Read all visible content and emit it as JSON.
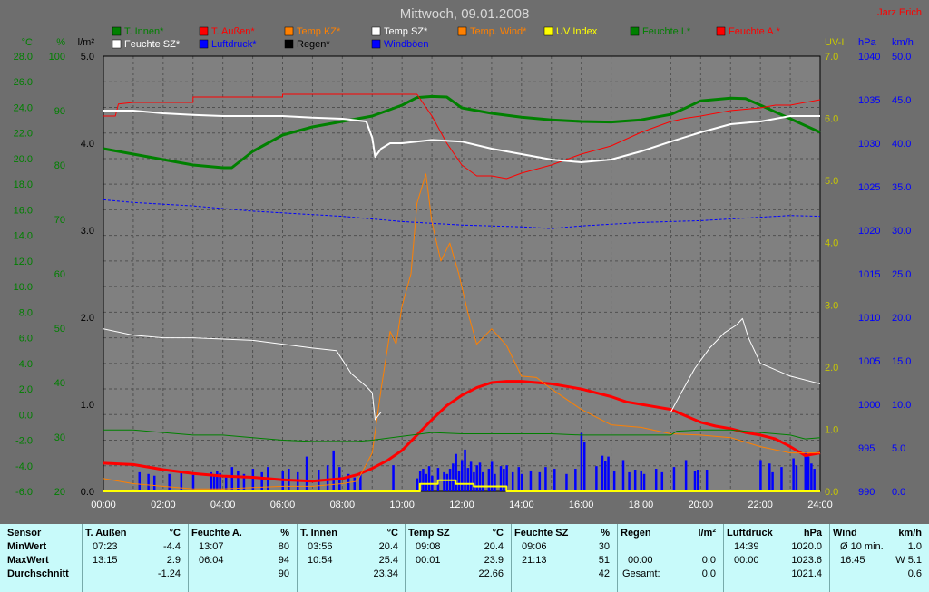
{
  "chart_data": {
    "type": "line",
    "title": "Mittwoch, 09.01.2008",
    "author": "Jarz Erich",
    "x_ticks": [
      "00:00",
      "02:00",
      "04:00",
      "06:00",
      "08:00",
      "10:00",
      "12:00",
      "14:00",
      "16:00",
      "18:00",
      "20:00",
      "22:00",
      "24:00"
    ],
    "xlim": [
      0,
      24
    ],
    "axes_left": [
      {
        "unit": "°C",
        "color": "#008000",
        "ticks": [
          "-6.0",
          "-4.0",
          "-2.0",
          "0.0",
          "2.0",
          "4.0",
          "6.0",
          "8.0",
          "10.0",
          "12.0",
          "14.0",
          "16.0",
          "18.0",
          "20.0",
          "22.0",
          "24.0",
          "26.0",
          "28.0"
        ],
        "ylim": [
          -6,
          28
        ]
      },
      {
        "unit": "%",
        "color": "#008000",
        "ticks": [
          "20",
          "30",
          "40",
          "50",
          "60",
          "70",
          "80",
          "90",
          "100"
        ],
        "ylim": [
          20,
          100
        ]
      },
      {
        "unit": "l/m²",
        "color": "#000000",
        "ticks": [
          "0.0",
          "1.0",
          "2.0",
          "3.0",
          "4.0",
          "5.0"
        ],
        "ylim": [
          0,
          5
        ]
      }
    ],
    "axes_right": [
      {
        "unit": "UV-I",
        "color": "#c8c800",
        "ticks": [
          "0.0",
          "1.0",
          "2.0",
          "3.0",
          "4.0",
          "5.0",
          "6.0",
          "7.0"
        ],
        "ylim": [
          0,
          7
        ]
      },
      {
        "unit": "hPa",
        "color": "#0000ff",
        "ticks": [
          "990",
          "995",
          "1000",
          "1005",
          "1010",
          "1015",
          "1020",
          "1025",
          "1030",
          "1035",
          "1040"
        ],
        "ylim": [
          990,
          1040
        ]
      },
      {
        "unit": "km/h",
        "color": "#0000ff",
        "ticks": [
          "0.0",
          "5.0",
          "10.0",
          "15.0",
          "20.0",
          "25.0",
          "30.0",
          "35.0",
          "40.0",
          "45.0",
          "50.0"
        ],
        "ylim": [
          0,
          50
        ]
      }
    ],
    "legend": [
      {
        "name": "T. Innen*",
        "color": "#008000"
      },
      {
        "name": "T. Außen*",
        "color": "#ff0000"
      },
      {
        "name": "Temp KZ*",
        "color": "#ff8000"
      },
      {
        "name": "Temp SZ*",
        "color": "#ffffff"
      },
      {
        "name": "Temp. Wind*",
        "color": "#ff8000"
      },
      {
        "name": "UV Index",
        "color": "#ffff00"
      },
      {
        "name": "Feuchte I.*",
        "color": "#008000"
      },
      {
        "name": "Feuchte A.*",
        "color": "#ff0000"
      },
      {
        "name": "Feuchte SZ*",
        "color": "#ffffff"
      },
      {
        "name": "Luftdruck*",
        "color": "#0000ff"
      },
      {
        "name": "Regen*",
        "color": "#000000"
      },
      {
        "name": "Windböen",
        "color": "#0000ff"
      }
    ],
    "series": [
      {
        "name": "T. Außen*",
        "axis": "°C",
        "color": "#ff0000",
        "width": 3,
        "x": [
          0,
          1,
          2,
          3,
          4,
          5,
          6,
          7,
          7.5,
          8,
          8.5,
          9,
          9.5,
          10,
          10.5,
          11,
          11.5,
          12,
          12.5,
          13,
          13.5,
          14,
          14.5,
          15,
          15.5,
          16,
          16.5,
          17,
          17.5,
          18,
          18.5,
          19,
          19.5,
          20,
          20.5,
          21,
          21.5,
          22,
          22.5,
          23,
          23.5,
          24
        ],
        "y": [
          -3.8,
          -3.9,
          -4.3,
          -4.6,
          -4.8,
          -4.9,
          -5.1,
          -5.2,
          -5.1,
          -5.0,
          -4.7,
          -4.2,
          -3.6,
          -2.8,
          -1.6,
          -0.4,
          0.7,
          1.5,
          2.1,
          2.5,
          2.6,
          2.6,
          2.5,
          2.4,
          2.2,
          2.0,
          1.7,
          1.4,
          1.0,
          0.8,
          0.6,
          0.4,
          -0.1,
          -0.6,
          -0.9,
          -1.1,
          -1.4,
          -1.6,
          -1.9,
          -2.5,
          -3.2,
          -3.0
        ]
      },
      {
        "name": "Temp KZ*",
        "axis": "°C",
        "color": "#ff8000",
        "width": 1,
        "x": [
          0,
          1,
          2,
          3,
          4,
          5,
          6,
          7,
          8,
          8.5,
          9,
          9.3,
          9.6,
          9.8,
          10,
          10.3,
          10.5,
          10.8,
          11,
          11.3,
          11.6,
          11.9,
          12.2,
          12.5,
          13,
          13.5,
          14,
          14.5,
          15,
          16,
          17,
          18,
          19,
          20,
          21,
          22,
          23,
          24
        ],
        "y": [
          -5.0,
          -5.4,
          -5.6,
          -5.8,
          -5.8,
          -5.7,
          -5.6,
          -5.6,
          -5.4,
          -5.2,
          -3.0,
          2.0,
          6.5,
          5.5,
          8.5,
          11.0,
          16.5,
          18.8,
          15.0,
          12.0,
          13.4,
          11.0,
          8.0,
          5.5,
          6.7,
          5.4,
          3.0,
          2.9,
          2.0,
          0.4,
          -0.8,
          -1.0,
          -1.5,
          -1.6,
          -1.8,
          -2.5,
          -3.0,
          -3.0
        ]
      },
      {
        "name": "Temp SZ*",
        "axis": "°C",
        "color": "#ffffff",
        "width": 1,
        "x": [
          0,
          1,
          2,
          3,
          4,
          5,
          6,
          7,
          7.8,
          8.3,
          8.8,
          9.0,
          9.1,
          9.3,
          10,
          12,
          14,
          16,
          17,
          18,
          19,
          19.3,
          19.8,
          20.3,
          20.8,
          21.2,
          21.4,
          21.6,
          22,
          23,
          24
        ],
        "y": [
          6.7,
          6.2,
          6.0,
          6.0,
          5.9,
          5.8,
          5.5,
          5.2,
          5.0,
          3.2,
          2.2,
          1.7,
          -0.4,
          0.2,
          0.2,
          0.2,
          0.2,
          0.2,
          0.2,
          0.2,
          0.2,
          1.5,
          3.6,
          5.2,
          6.4,
          7.0,
          7.5,
          6.0,
          4.0,
          3.0,
          2.4
        ]
      },
      {
        "name": "T. Innen*",
        "axis": "°C",
        "color": "#008000",
        "width": 1,
        "x": [
          0,
          1,
          2,
          3,
          4,
          5,
          6,
          7,
          8,
          8.5,
          9,
          10,
          11,
          12,
          13,
          14,
          15,
          16,
          17,
          18,
          19,
          19.2,
          20,
          21,
          22,
          23,
          23.5,
          24
        ],
        "y": [
          -1.2,
          -1.2,
          -1.4,
          -1.6,
          -1.6,
          -1.8,
          -2.0,
          -2.1,
          -2.1,
          -2.1,
          -2.0,
          -1.7,
          -1.4,
          -1.5,
          -1.5,
          -1.5,
          -1.5,
          -1.6,
          -1.6,
          -1.6,
          -1.6,
          -1.3,
          -1.2,
          -1.2,
          -1.4,
          -1.6,
          -1.9,
          -1.8
        ]
      },
      {
        "name": "Feuchte I.*",
        "axis": "%",
        "color": "#008000",
        "width": 3,
        "x": [
          0,
          1,
          2,
          3,
          4,
          4.3,
          5,
          6,
          7,
          8,
          9,
          10,
          10.5,
          11,
          11.5,
          12,
          13,
          14,
          15,
          16,
          17,
          18,
          19,
          19.5,
          20,
          21,
          21.5,
          22,
          23,
          24
        ],
        "y": [
          83.0,
          82.0,
          81.0,
          80.0,
          79.5,
          79.5,
          82.5,
          85.5,
          87.0,
          88.0,
          89.0,
          91.0,
          92.4,
          92.6,
          92.5,
          90.5,
          89.5,
          88.8,
          88.3,
          88.0,
          87.9,
          88.3,
          89.3,
          90.5,
          91.8,
          92.3,
          92.2,
          91.0,
          88.5,
          86.0
        ]
      },
      {
        "name": "Feuchte A.*",
        "axis": "%",
        "color": "#ff0000",
        "width": 1,
        "x": [
          0,
          0.4,
          0.5,
          1,
          2,
          3,
          3,
          4,
          5,
          6,
          6,
          7,
          8,
          9,
          10,
          10.5,
          11,
          11.5,
          12,
          12.5,
          13,
          13.5,
          14,
          15,
          15.5,
          16,
          17,
          18,
          19,
          19.5,
          20,
          21,
          22,
          22.5,
          23,
          24
        ],
        "y": [
          89.0,
          89.0,
          91.2,
          91.5,
          91.5,
          91.5,
          92.5,
          92.5,
          92.5,
          92.5,
          93.0,
          93.0,
          93.0,
          93.0,
          93.0,
          93.0,
          89.0,
          84.0,
          80.0,
          78.0,
          78.0,
          77.5,
          78.5,
          80.0,
          81.0,
          82.0,
          83.5,
          86.0,
          88.0,
          88.6,
          89.0,
          90.0,
          90.5,
          91.0,
          91.0,
          92.0
        ]
      },
      {
        "name": "Feuchte SZ*",
        "axis": "%",
        "color": "#ffffff",
        "width": 2,
        "x": [
          0,
          1,
          2,
          3,
          4,
          5,
          6,
          7,
          8,
          8.8,
          9.0,
          9.1,
          9.3,
          9.6,
          10,
          11,
          12,
          13,
          14,
          15,
          16,
          17,
          18,
          19,
          20,
          21,
          22,
          23,
          24
        ],
        "y": [
          90.0,
          90.0,
          89.5,
          89.2,
          89.0,
          89.0,
          89.0,
          88.7,
          88.5,
          88.0,
          85.0,
          81.5,
          83.0,
          84.0,
          84.0,
          84.6,
          84.3,
          83.0,
          82.0,
          81.0,
          80.5,
          81.0,
          82.5,
          84.3,
          86.0,
          87.5,
          88.0,
          89.0,
          89.0
        ]
      },
      {
        "name": "Luftdruck*",
        "axis": "hPa",
        "color": "#0000ff",
        "width": 1,
        "dashed": true,
        "x": [
          0,
          1,
          2,
          3,
          4,
          5,
          6,
          7,
          8,
          9,
          10,
          11,
          12,
          13,
          14,
          15,
          16,
          17,
          18,
          19,
          20,
          21,
          22,
          23,
          24
        ],
        "y": [
          1023.5,
          1023.2,
          1023.0,
          1022.8,
          1022.5,
          1022.2,
          1022.0,
          1021.8,
          1021.6,
          1021.3,
          1021.0,
          1020.8,
          1020.6,
          1020.5,
          1020.4,
          1020.2,
          1020.5,
          1020.7,
          1020.9,
          1021.0,
          1021.1,
          1021.3,
          1021.5,
          1021.7,
          1021.6
        ]
      },
      {
        "name": "UV Index",
        "axis": "UV-I",
        "color": "#ffff00",
        "width": 2,
        "x": [
          0,
          10.6,
          10.6,
          11.2,
          11.2,
          11.8,
          11.8,
          12.4,
          12.4,
          13.5,
          13.5,
          24
        ],
        "y": [
          0,
          0,
          0.12,
          0.12,
          0.18,
          0.18,
          0.12,
          0.12,
          0.08,
          0.08,
          0,
          0
        ]
      },
      {
        "name": "Windböen",
        "axis": "km/h",
        "color": "#0000ff",
        "type": "bar",
        "x": [
          1.2,
          1.5,
          1.7,
          2.2,
          2.6,
          3.0,
          3.6,
          3.7,
          3.8,
          3.9,
          4.1,
          4.3,
          4.5,
          4.7,
          5.0,
          5.3,
          5.5,
          6.0,
          6.2,
          6.5,
          6.8,
          7.2,
          7.5,
          7.7,
          7.9,
          8.2,
          8.4,
          8.6,
          9.7,
          10.5,
          10.6,
          10.7,
          10.8,
          10.9,
          11.0,
          11.2,
          11.4,
          11.5,
          11.6,
          11.7,
          11.8,
          11.9,
          12.0,
          12.1,
          12.2,
          12.3,
          12.4,
          12.5,
          12.6,
          12.7,
          12.9,
          13.0,
          13.1,
          13.3,
          13.4,
          13.5,
          13.7,
          13.9,
          14.0,
          14.3,
          14.6,
          14.8,
          15.1,
          15.5,
          15.8,
          16.0,
          16.1,
          16.5,
          16.7,
          16.8,
          16.9,
          17.1,
          17.4,
          17.6,
          17.8,
          18.0,
          18.1,
          18.5,
          18.7,
          19.1,
          19.5,
          19.8,
          19.9,
          20.2,
          22.0,
          22.3,
          22.4,
          22.7,
          23.1,
          23.2,
          23.5,
          23.6,
          23.7,
          23.8
        ],
        "y": [
          2.2,
          2.0,
          1.8,
          2.0,
          2.3,
          1.9,
          2.2,
          1.8,
          2.3,
          2.1,
          1.6,
          2.8,
          2.4,
          2.0,
          2.6,
          2.2,
          2.8,
          2.3,
          2.6,
          2.2,
          4.0,
          2.5,
          3.0,
          4.7,
          2.8,
          2.0,
          1.6,
          2.2,
          3.0,
          1.5,
          2.3,
          2.6,
          2.0,
          2.9,
          1.8,
          2.7,
          2.2,
          2.0,
          2.6,
          3.2,
          4.3,
          2.4,
          3.6,
          4.8,
          2.7,
          3.4,
          2.2,
          3.0,
          3.3,
          2.2,
          2.6,
          3.4,
          2.0,
          2.9,
          2.6,
          3.0,
          2.2,
          2.8,
          2.0,
          2.4,
          2.2,
          2.8,
          2.6,
          2.0,
          2.6,
          6.7,
          5.7,
          2.9,
          4.1,
          3.5,
          4.0,
          2.4,
          3.6,
          2.2,
          2.5,
          2.4,
          2.0,
          2.6,
          2.2,
          2.8,
          3.6,
          2.3,
          2.5,
          2.5,
          3.6,
          3.2,
          2.2,
          2.8,
          3.8,
          3.0,
          4.5,
          4.0,
          3.2,
          2.6
        ]
      }
    ]
  },
  "stats": {
    "row_labels": [
      "Sensor",
      "MinWert",
      "MaxWert",
      "Durchschnitt"
    ],
    "columns": [
      {
        "name": "T. Außen",
        "unit": "°C",
        "min_time": "07:23",
        "min": "-4.4",
        "max_time": "13:15",
        "max": "2.9",
        "avg": "-1.24"
      },
      {
        "name": "Feuchte A.",
        "unit": "%",
        "min_time": "13:07",
        "min": "80",
        "max_time": "06:04",
        "max": "94",
        "avg": "90"
      },
      {
        "name": "T. Innen",
        "unit": "°C",
        "min_time": "03:56",
        "min": "20.4",
        "max_time": "10:54",
        "max": "25.4",
        "avg": "23.34"
      },
      {
        "name": "Temp SZ",
        "unit": "°C",
        "min_time": "09:08",
        "min": "20.4",
        "max_time": "00:01",
        "max": "23.9",
        "avg": "22.66"
      },
      {
        "name": "Feuchte SZ",
        "unit": "%",
        "min_time": "09:06",
        "min": "30",
        "max_time": "21:13",
        "max": "51",
        "avg": "42"
      },
      {
        "name": "Regen",
        "unit": "l/m²",
        "min_time": "",
        "min": "",
        "max_time": "00:00",
        "max": "0.0",
        "avg_label": "Gesamt:",
        "avg": "0.0"
      },
      {
        "name": "Luftdruck",
        "unit": "hPa",
        "min_time": "14:39",
        "min": "1020.0",
        "max_time": "00:00",
        "max": "1023.6",
        "avg": "1021.4"
      },
      {
        "name": "Wind",
        "unit": "km/h",
        "min_time": "Ø 10 min.",
        "min": "1.0",
        "max_time": "16:45",
        "max": "W 5.1",
        "avg": "0.6"
      }
    ]
  }
}
